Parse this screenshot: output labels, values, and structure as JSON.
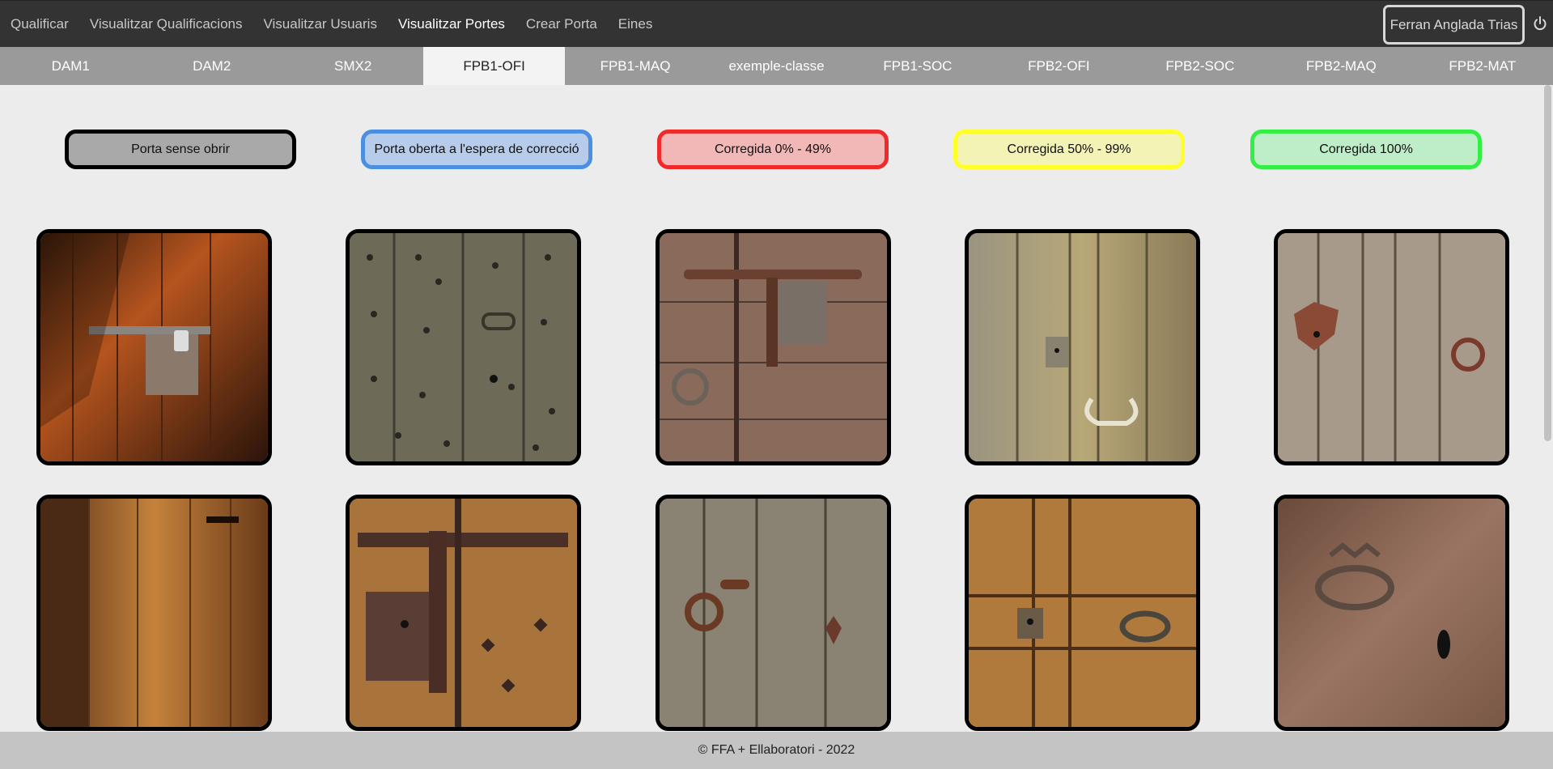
{
  "nav": {
    "items": [
      "Qualificar",
      "Visualitzar Qualificacions",
      "Visualitzar Usuaris",
      "Visualitzar Portes",
      "Crear Porta",
      "Eines"
    ],
    "active": "Visualitzar Portes",
    "user": "Ferran Anglada Trias",
    "power_icon": "power-icon"
  },
  "tabs": {
    "items": [
      "DAM1",
      "DAM2",
      "SMX2",
      "FPB1-OFI",
      "FPB1-MAQ",
      "exemple-classe",
      "FPB1-SOC",
      "FPB2-OFI",
      "FPB2-SOC",
      "FPB2-MAQ",
      "FPB2-MAT"
    ],
    "active": "FPB1-OFI"
  },
  "legend": [
    {
      "label": "Porta sense obrir",
      "color": "#a9a9a9",
      "border": "#000000"
    },
    {
      "label": "Porta oberta a l'espera de correcció",
      "color": "#b6ccea",
      "border": "#4a8fe0"
    },
    {
      "label": "Corregida 0% - 49%",
      "color": "#f2b7b7",
      "border": "#ee2a2a"
    },
    {
      "label": "Corregida 50% - 99%",
      "color": "#f3f3b5",
      "border": "#ffff2a"
    },
    {
      "label": "Corregida 100%",
      "color": "#bdeec7",
      "border": "#33ee44"
    }
  ],
  "doors": [
    {
      "status": "Porta sense obrir",
      "image": "door-photo-1"
    },
    {
      "status": "Porta sense obrir",
      "image": "door-photo-2"
    },
    {
      "status": "Porta sense obrir",
      "image": "door-photo-3"
    },
    {
      "status": "Porta sense obrir",
      "image": "door-photo-4"
    },
    {
      "status": "Porta sense obrir",
      "image": "door-photo-5"
    },
    {
      "status": "Porta sense obrir",
      "image": "door-photo-6"
    },
    {
      "status": "Porta sense obrir",
      "image": "door-photo-7"
    },
    {
      "status": "Porta sense obrir",
      "image": "door-photo-8"
    },
    {
      "status": "Porta sense obrir",
      "image": "door-photo-9"
    },
    {
      "status": "Porta sense obrir",
      "image": "door-photo-10"
    }
  ],
  "footer": "© FFA + Ellaboratori - 2022"
}
